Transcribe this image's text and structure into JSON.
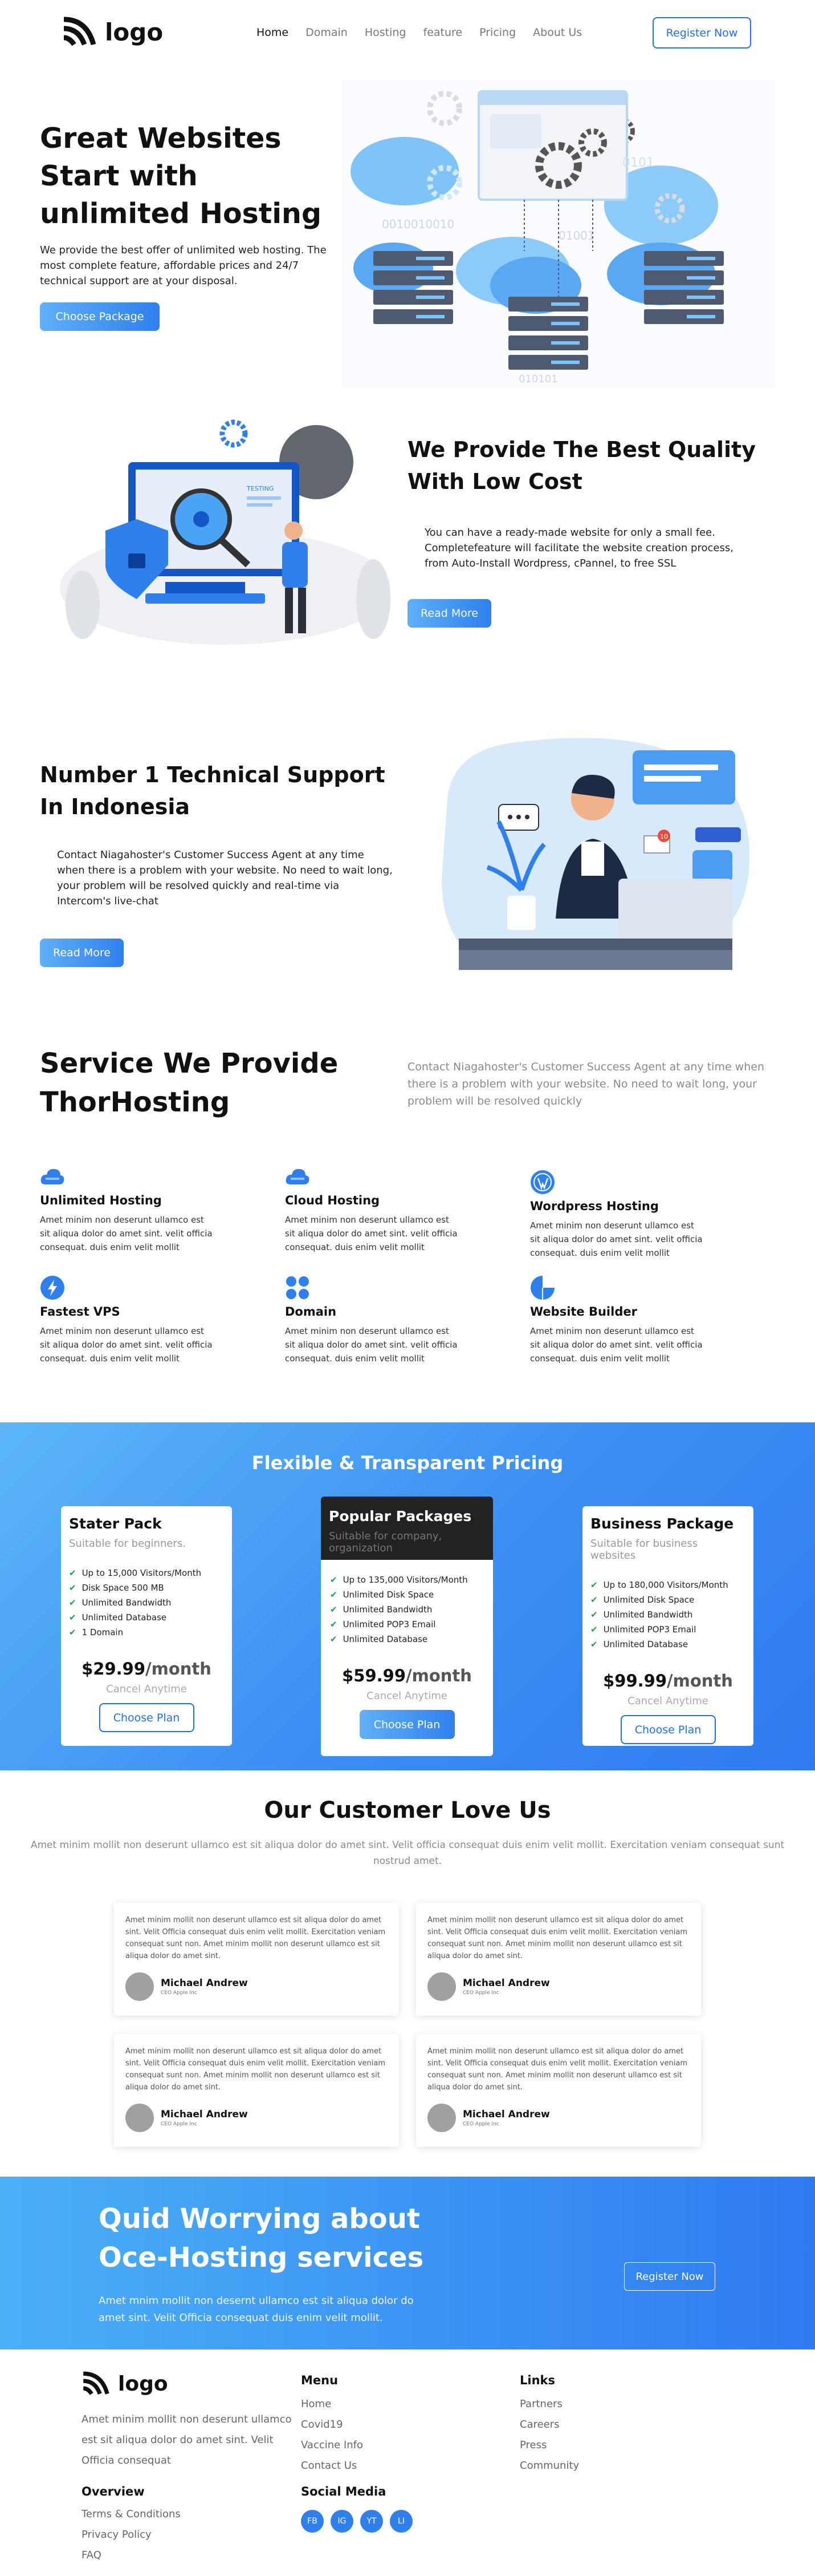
{
  "nav": {
    "logo_text": "logo",
    "links": [
      "Home",
      "Domain",
      "Hosting",
      "feature",
      "Pricing",
      "About Us"
    ],
    "register_label": "Register Now"
  },
  "hero": {
    "title": "Great Websites Start with unlimited Hosting",
    "text": "We provide the best offer of unlimited web hosting. The most complete feature, affordable prices and 24/7 technical support are at your disposal.",
    "button": "Choose Package",
    "art_binary": [
      "0101",
      "0010010010",
      "01001",
      "010101"
    ]
  },
  "quality": {
    "title": "We Provide The Best Quality With Low Cost",
    "text": "You can have a ready-made website for only a small fee. Completefeature will facilitate the website creation process, from Auto-Install Wordpress, cPannel, to free SSL",
    "button": "Read More",
    "art_label": "TESTING"
  },
  "support": {
    "title": "Number 1 Technical Support In Indonesia",
    "text": "Contact Niagahoster's Customer Success Agent at any time when there is a problem with your website. No need to wait long, your problem will be resolved quickly and real-time via Intercom's live-chat",
    "button": "Read More",
    "art_badge": "10"
  },
  "services": {
    "title": "Service We Provide ThorHosting",
    "subtitle": "Contact Niagahoster's Customer Success Agent at any time when there is a problem with your website. No need to wait long, your problem will be resolved quickly",
    "items": [
      {
        "title": "Unlimited Hosting",
        "desc": "Amet minim non deserunt ullamco est sit aliqua dolor do amet sint. velit officia consequat. duis enim velit mollit",
        "icon": "cloud-icon"
      },
      {
        "title": "Cloud Hosting",
        "desc": "Amet minim non deserunt ullamco est sit aliqua dolor do amet sint. velit officia consequat. duis enim velit mollit",
        "icon": "cloud-icon"
      },
      {
        "title": "Wordpress Hosting",
        "desc": "Amet minim non deserunt ullamco est sit aliqua dolor do amet sint. velit officia consequat. duis enim velit mollit",
        "icon": "wordpress-icon"
      },
      {
        "title": "Fastest VPS",
        "desc": "Amet minim non deserunt ullamco est sit aliqua dolor do amet sint. velit officia consequat. duis enim velit mollit",
        "icon": "lightning-icon"
      },
      {
        "title": "Domain",
        "desc": "Amet minim non deserunt ullamco est sit aliqua dolor do amet sint. velit officia consequat. duis enim velit mollit",
        "icon": "grid-icon"
      },
      {
        "title": "Website Builder",
        "desc": "Amet minim non deserunt ullamco est sit aliqua dolor do amet sint. velit officia consequat. duis enim velit mollit",
        "icon": "pie-icon"
      }
    ]
  },
  "pricing": {
    "title": "Flexible & Transparent Pricing",
    "plans": [
      {
        "name": "Stater Pack",
        "sub": "Suitable for beginners.",
        "features": [
          "Up to 15,000 Visitors/Month",
          "Disk Space 500 MB",
          "Unlimited Bandwidth",
          "Unlimited Database",
          "1 Domain"
        ],
        "price": "$29.99",
        "per": "/month",
        "cancel": "Cancel Anytime",
        "button": "Choose Plan"
      },
      {
        "name": "Popular Packages",
        "sub": "Suitable for company, organization",
        "features": [
          "Up to 135,000 Visitors/Month",
          "Unlimited Disk Space",
          "Unlimited Bandwidth",
          "Unlimited POP3 Email",
          "Unlimited Database"
        ],
        "price": "$59.99",
        "per": "/month",
        "cancel": "Cancel Anytime",
        "button": "Choose Plan"
      },
      {
        "name": "Business Package",
        "sub": "Suitable for business websites",
        "features": [
          "Up to 180,000 Visitors/Month",
          "Unlimited Disk Space",
          "Unlimited Bandwidth",
          "Unlimited POP3 Email",
          "Unlimited Database"
        ],
        "price": "$99.99",
        "per": "/month",
        "cancel": "Cancel Anytime",
        "button": "Choose Plan"
      }
    ]
  },
  "testimonials": {
    "title": "Our Customer Love Us",
    "subtitle": "Amet minim mollit non deserunt ullamco est sit aliqua dolor do amet sint. Velit officia consequat duis enim velit mollit. Exercitation veniam consequat sunt nostrud amet.",
    "cards": [
      {
        "text": "Amet minim mollit non deserunt ullamco est sit aliqua dolor do amet sint. Velit Officia consequat duis enim velit mollit. Exercitation veniam consequat sunt non. Amet minim mollit non deserunt ullamco est sit aliqua dolor do amet sint.",
        "name": "Michael Andrew",
        "role": "CEO Apple Inc"
      },
      {
        "text": "Amet minim mollit non deserunt ullamco est sit aliqua dolor do amet sint. Velit Officia consequat duis enim velit mollit. Exercitation veniam consequat sunt non. Amet minim mollit non deserunt ullamco est sit aliqua dolor do amet sint.",
        "name": "Michael Andrew",
        "role": "CEO Apple Inc"
      },
      {
        "text": "Amet minim mollit non deserunt ullamco est sit aliqua dolor do amet sint. Velit Officia consequat duis enim velit mollit. Exercitation veniam consequat sunt non. Amet minim mollit non deserunt ullamco est sit aliqua dolor do amet sint.",
        "name": "Michael Andrew",
        "role": "CEO Apple Inc"
      },
      {
        "text": "Amet minim mollit non deserunt ullamco est sit aliqua dolor do amet sint. Velit Officia consequat duis enim velit mollit. Exercitation veniam consequat sunt non. Amet minim mollit non deserunt ullamco est sit aliqua dolor do amet sint.",
        "name": "Michael Andrew",
        "role": "CEO Apple Inc"
      }
    ]
  },
  "cta": {
    "title_line1": "Quid Worrying about",
    "title_line2": "Oce-Hosting services",
    "text": "Amet mnim mollit non desernt ullamco est sit aliqua dolor do amet sint. Velit Officia consequat duis enim velit mollit.",
    "button": "Register Now"
  },
  "footer": {
    "logo_text": "logo",
    "about": "Amet minim mollit non deserunt ullamco est sit aliqua dolor do amet sint. Velit Officia consequat",
    "menu_title": "Menu",
    "menu": [
      "Home",
      "Covid19",
      "Vaccine Info",
      "Contact Us"
    ],
    "links_title": "Links",
    "links": [
      "Partners",
      "Careers",
      "Press",
      "Community"
    ],
    "overview_title": "Overview",
    "overview": [
      "Terms & Conditions",
      "Privacy Policy",
      "FAQ"
    ],
    "social_title": "Social Media",
    "social": [
      "FB",
      "IG",
      "YT",
      "LI"
    ]
  },
  "colors": {
    "accent": "#2f80ed",
    "accent_light": "#5fb0f7",
    "dark": "#222222"
  }
}
